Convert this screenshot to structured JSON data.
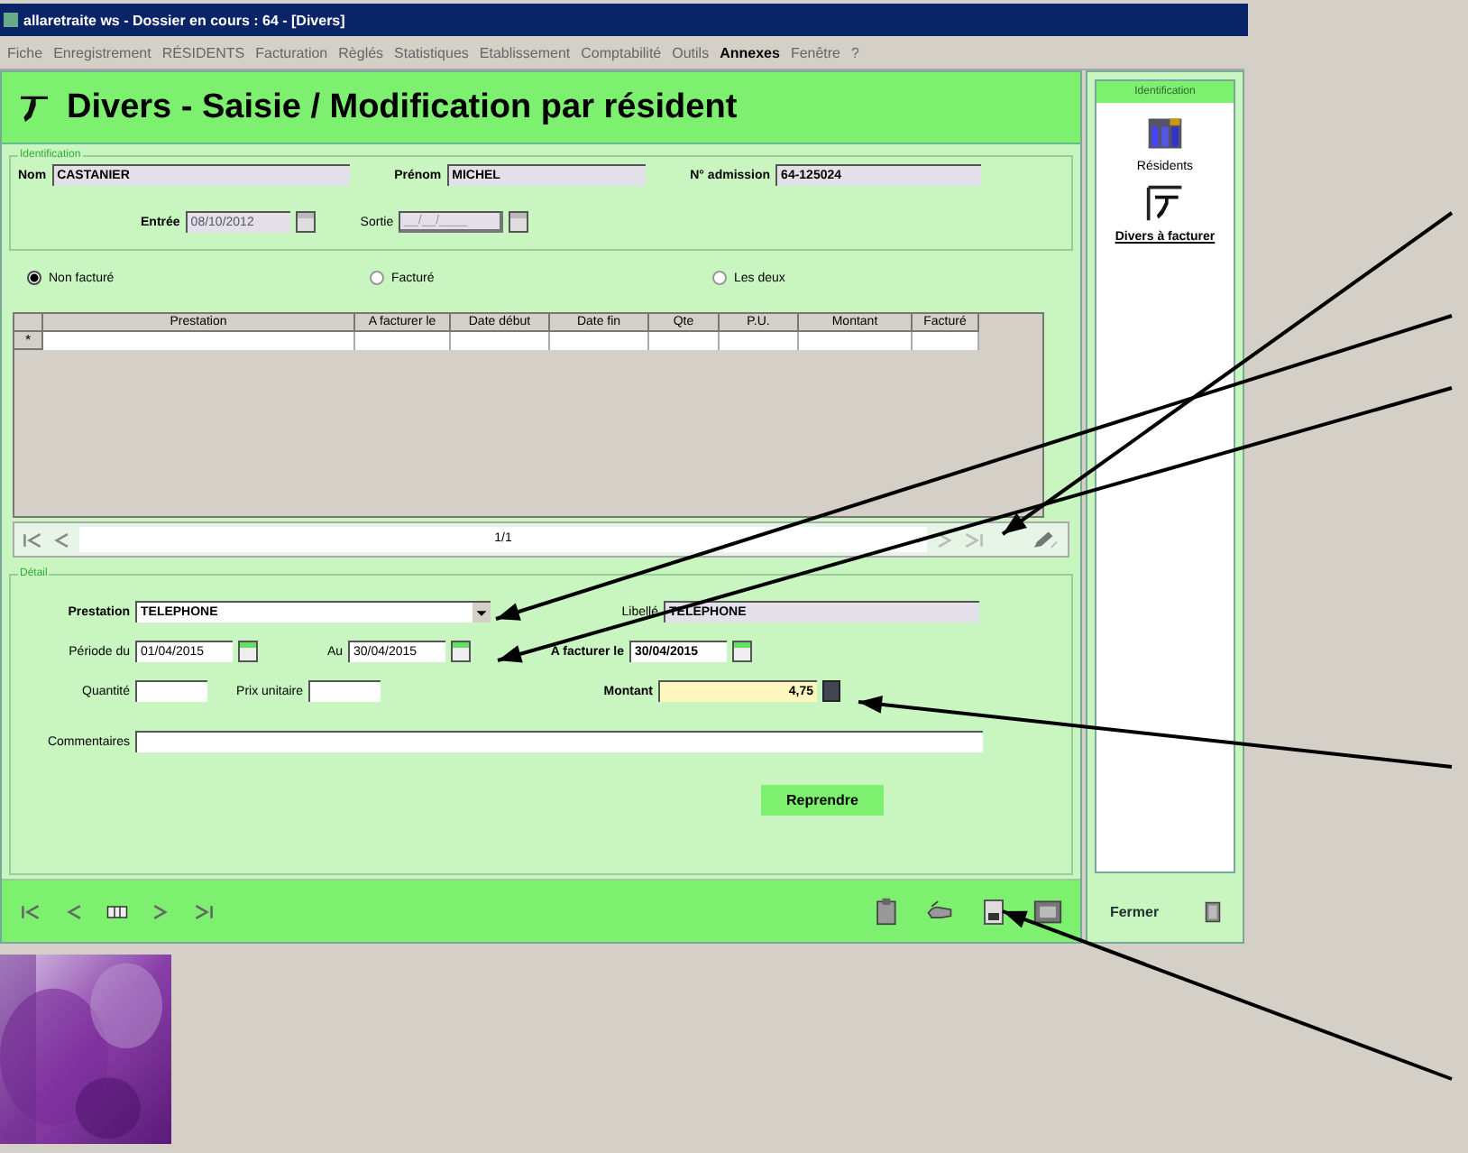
{
  "window": {
    "title": "allaretraite ws - Dossier en cours : 64 - [Divers]"
  },
  "menu": [
    {
      "label": "Fiche",
      "disabled": true
    },
    {
      "label": "Enregistrement",
      "disabled": true
    },
    {
      "label": "RÉSIDENTS",
      "disabled": true
    },
    {
      "label": "Facturation",
      "disabled": true
    },
    {
      "label": "Règlés",
      "disabled": true
    },
    {
      "label": "Statistiques",
      "disabled": true
    },
    {
      "label": "Etablissement",
      "disabled": true
    },
    {
      "label": "Comptabilité",
      "disabled": true
    },
    {
      "label": "Outils",
      "disabled": true
    },
    {
      "label": "Annexes",
      "disabled": false
    },
    {
      "label": "Fenêtre",
      "disabled": true
    },
    {
      "label": "?",
      "disabled": true
    }
  ],
  "header": {
    "title": "Divers - Saisie / Modification par résident"
  },
  "identification": {
    "legend": "Identification",
    "nom": {
      "label": "Nom",
      "value": "CASTANIER"
    },
    "prenom": {
      "label": "Prénom",
      "value": "MICHEL"
    },
    "admission": {
      "label": "N° admission",
      "value": "64-125024"
    },
    "entree": {
      "label": "Entrée",
      "value": "08/10/2012"
    },
    "sortie": {
      "label": "Sortie",
      "placeholder": "__/__/____"
    }
  },
  "filter": [
    {
      "label": "Non facturé",
      "selected": true
    },
    {
      "label": "Facturé",
      "selected": false
    },
    {
      "label": "Les deux",
      "selected": false
    }
  ],
  "table": {
    "columns": [
      "Prestation",
      "A facturer le",
      "Date début",
      "Date fin",
      "Qte",
      "P.U.",
      "Montant",
      "Facturé"
    ],
    "new_row_marker": "*"
  },
  "pager": {
    "position": "1/1"
  },
  "detail": {
    "legend": "Détail",
    "prestation": {
      "label": "Prestation",
      "value": "TELEPHONE"
    },
    "libelle": {
      "label": "Libellé",
      "value": "TELEPHONE"
    },
    "periode_du": {
      "label": "Période du",
      "value": "01/04/2015"
    },
    "au": {
      "label": "Au",
      "value": "30/04/2015"
    },
    "a_facturer_le": {
      "label": "A facturer le",
      "value": "30/04/2015"
    },
    "quantite": {
      "label": "Quantité"
    },
    "prix_unitaire": {
      "label": "Prix unitaire"
    },
    "montant": {
      "label": "Montant",
      "value": "4,75"
    },
    "commentaires": {
      "label": "Commentaires"
    }
  },
  "reprendre_button": "Reprendre",
  "side_panel": {
    "header": "Identification",
    "items": [
      {
        "label": "Résidents",
        "selected": false
      },
      {
        "label": "Divers à facturer",
        "selected": true
      }
    ],
    "close_button": "Fermer"
  }
}
